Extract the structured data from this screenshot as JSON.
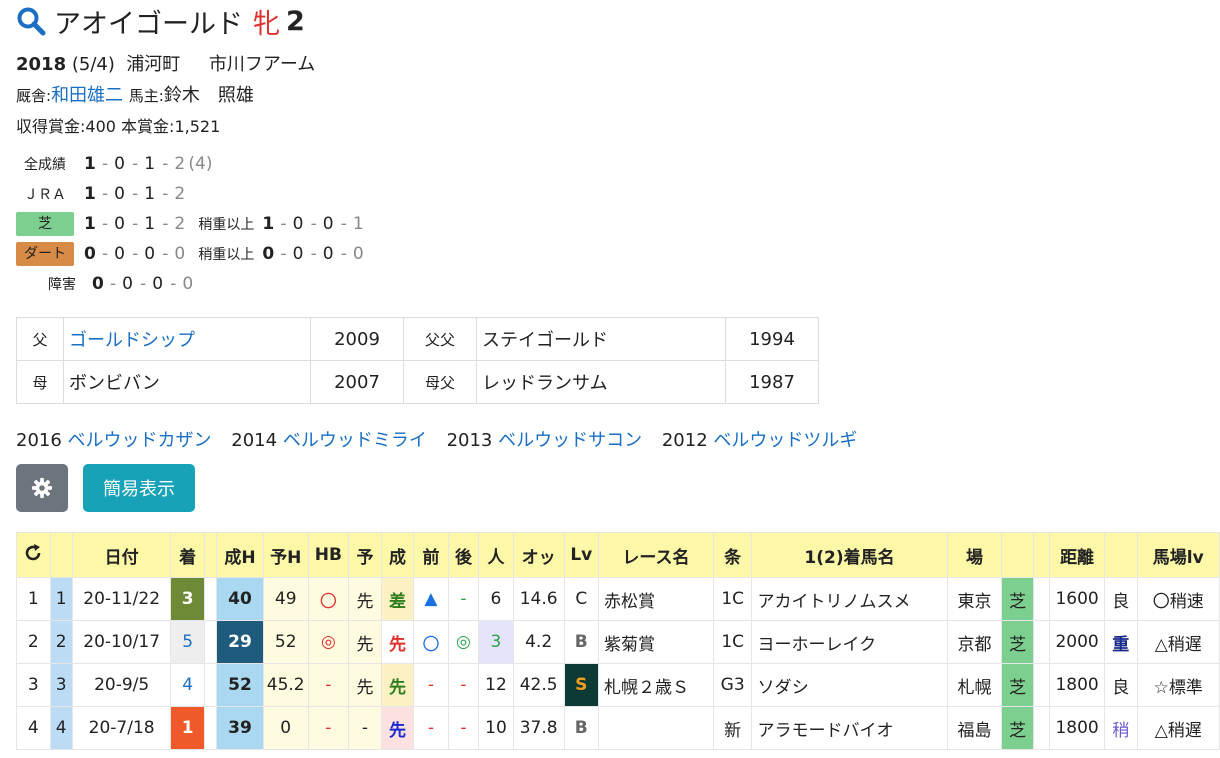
{
  "horse": {
    "name": "アオイゴールド",
    "sex": "牝",
    "age": "2"
  },
  "profile": {
    "birth_year": "2018",
    "birth_date": "(5/4)",
    "birthplace": "浦河町",
    "breeder": "市川フアーム",
    "trainer_label": "厩舎:",
    "trainer": "和田雄二",
    "owner_label": "馬主:",
    "owner": "鈴木　照雄",
    "prize_label": "収得賞金:",
    "prize": "400",
    "total_label": "本賞金:",
    "total": "1,521"
  },
  "records": [
    {
      "label": "全成績",
      "v": [
        "1",
        "0",
        "1",
        "2"
      ],
      "extra": "(4)"
    },
    {
      "label": "ＪＲＡ",
      "v": [
        "1",
        "0",
        "1",
        "2"
      ]
    },
    {
      "label": "芝",
      "v": [
        "1",
        "0",
        "1",
        "2"
      ],
      "sub_label": "稍重以上",
      "sub_v": [
        "1",
        "0",
        "0",
        "1"
      ]
    },
    {
      "label": "ダート",
      "v": [
        "0",
        "0",
        "0",
        "0"
      ],
      "sub_label": "稍重以上",
      "sub_v": [
        "0",
        "0",
        "0",
        "0"
      ]
    },
    {
      "label": "障害",
      "v": [
        "0",
        "0",
        "0",
        "0"
      ]
    }
  ],
  "pedigree": [
    {
      "k1": "父",
      "name1": "ゴールドシップ",
      "y1": "2009",
      "k2": "父父",
      "name2": "ステイゴールド",
      "y2": "1994"
    },
    {
      "k1": "母",
      "name1": "ボンビバン",
      "y1": "2007",
      "k2": "母父",
      "name2": "レッドランサム",
      "y2": "1987"
    }
  ],
  "siblings": [
    {
      "year": "2016",
      "name": "ベルウッドカザン"
    },
    {
      "year": "2014",
      "name": "ベルウッドミライ"
    },
    {
      "year": "2013",
      "name": "ベルウッドサコン"
    },
    {
      "year": "2012",
      "name": "ベルウッドツルギ"
    }
  ],
  "buttons": {
    "gear": "gear-icon",
    "simple": "簡易表示"
  },
  "table": {
    "headers": [
      "",
      "",
      "日付",
      "着",
      "",
      "成H",
      "予H",
      "HB",
      "予",
      "成",
      "前",
      "後",
      "人",
      "オッ",
      "Lv",
      "レース名",
      "条",
      "1(2)着馬名",
      "場",
      "",
      "",
      "距離",
      "",
      "馬場lv"
    ],
    "rows": [
      [
        "1",
        "1",
        "20-11/22",
        "3",
        "",
        "40",
        "49",
        "〇",
        "先",
        "差",
        "▲",
        "-",
        "6",
        "14.6",
        "C",
        "赤松賞",
        "1C",
        "アカイトリノムスメ",
        "東京",
        "芝",
        "",
        "1600",
        "良",
        "〇稍速"
      ],
      [
        "2",
        "2",
        "20-10/17",
        "5",
        "",
        "29",
        "52",
        "◎",
        "先",
        "先",
        "〇",
        "◎",
        "3",
        "4.2",
        "B",
        "紫菊賞",
        "1C",
        "ヨーホーレイク",
        "京都",
        "芝",
        "",
        "2000",
        "重",
        "△稍遅"
      ],
      [
        "3",
        "3",
        "20-9/5",
        "4",
        "",
        "52",
        "45.2",
        "-",
        "先",
        "先",
        "-",
        "-",
        "12",
        "42.5",
        "S",
        "札幌２歳Ｓ",
        "G3",
        "ソダシ",
        "札幌",
        "芝",
        "",
        "1800",
        "良",
        "☆標準"
      ],
      [
        "4",
        "4",
        "20-7/18",
        "1",
        "",
        "39",
        "0",
        "-",
        "-",
        "先",
        "-",
        "-",
        "10",
        "37.8",
        "B",
        "",
        "新",
        "アラモードバイオ",
        "福島",
        "芝",
        "",
        "1800",
        "稍",
        "△稍遅"
      ]
    ]
  },
  "colors": {
    "link": "#1a6fc4",
    "header_bg": "#fdf7a8",
    "shiba": "#7ccf8e",
    "dirt": "#d88b46",
    "sex": "#e0302d"
  }
}
